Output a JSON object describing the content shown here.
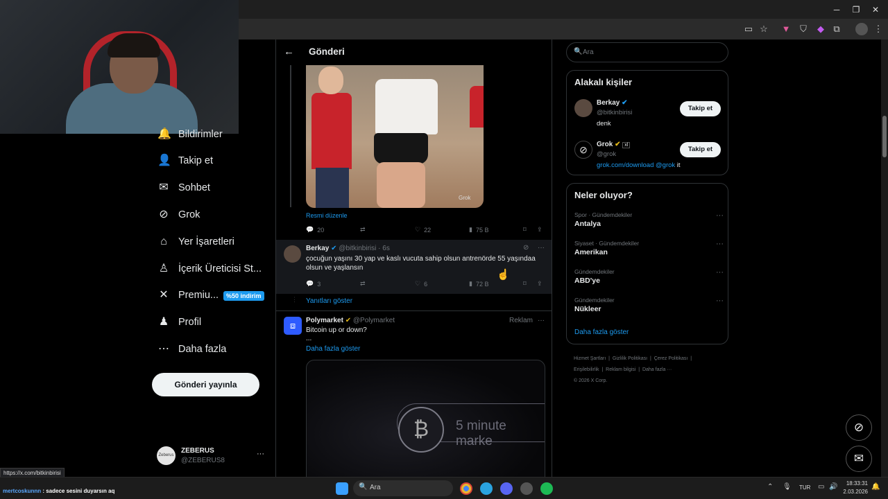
{
  "window": {
    "minimize_icon": "─",
    "maximize_icon": "❐",
    "close_icon": "✕"
  },
  "left_nav": {
    "items": [
      {
        "label": "Bildirimler",
        "icon": "bell-icon",
        "glyph": "🔔"
      },
      {
        "label": "Takip et",
        "icon": "person-plus-icon",
        "glyph": "⁺"
      },
      {
        "label": "Sohbet",
        "icon": "mail-icon",
        "glyph": "✉"
      },
      {
        "label": "Grok",
        "icon": "grok-icon",
        "glyph": "⊘"
      },
      {
        "label": "Yer İşaretleri",
        "icon": "bookmark-icon",
        "glyph": "🔖"
      },
      {
        "label": "İçerik Üreticisi St...",
        "icon": "creator-icon",
        "glyph": "♙"
      },
      {
        "label": "Premiu...",
        "icon": "x-logo-icon",
        "glyph": "✕"
      },
      {
        "label": "Profil",
        "icon": "profile-icon",
        "glyph": "👤"
      },
      {
        "label": "Daha fazla",
        "icon": "more-circle-icon",
        "glyph": "⋯"
      }
    ],
    "premium_badge": "%50 indirim",
    "post_button": "Gönderi yayınla",
    "profile": {
      "name": "ZEBERUS",
      "handle": "@ZEBERUS8",
      "avatar_text": "Zeberus",
      "menu": "···"
    }
  },
  "center": {
    "header_title": "Gönderi",
    "image_watermark": "Grok",
    "edited_label": "Resmi düzenle",
    "main_actions": {
      "replies": "20",
      "likes": "22",
      "views": "75 B"
    },
    "reply": {
      "name": "Berkay",
      "handle": "@bitkinbirisi",
      "time": "· 6s",
      "text": "çocuğun yaşını 30 yap ve kaslı vucuta sahip olsun antrenörde 55 yaşındaa olsun ve yaşlansın",
      "replies": "3",
      "likes": "6",
      "views": "72 B"
    },
    "show_replies": "Yanıtları göster",
    "ad": {
      "name": "Polymarket",
      "handle": "@Polymarket",
      "tag": "Reklam",
      "text": "Bitcoin up or down?",
      "ellipsis": "...",
      "show_more": "Daha fazla göster",
      "image_text": "5 minute marke",
      "coin_symbol": "₿"
    }
  },
  "right": {
    "search_placeholder": "Ara",
    "related_title": "Alakalı kişiler",
    "people": [
      {
        "name": "Berkay",
        "handle": "@bitkinbirisi",
        "bio": "denk",
        "button": "Takip et"
      },
      {
        "name": "Grok",
        "handle": "@grok",
        "bio_link": "grok.com/download @grok",
        "bio_tail": " it",
        "button": "Takip et",
        "tag": "xl"
      }
    ],
    "trends_title": "Neler oluyor?",
    "trends": [
      {
        "meta": "Spor · Gündemdekiler",
        "name": "Antalya"
      },
      {
        "meta": "Siyaset · Gündemdekiler",
        "name": "Amerikan"
      },
      {
        "meta": "Gündemdekiler",
        "name": "ABD'ye"
      },
      {
        "meta": "Gündemdekiler",
        "name": "Nükleer"
      }
    ],
    "trends_more": "Daha fazla göster",
    "footer_links": [
      "Hizmet Şartları",
      "Gizlilik Politikası",
      "Çerez Politikası",
      "Erişilebilirlik",
      "Reklam bilgisi",
      "Daha fazla ···"
    ],
    "copyright": "© 2026 X Corp."
  },
  "status_url": "https://x.com/bitkinbirisi",
  "chat": {
    "user": "mertcoskunnn",
    "message": " : sadece sesini duyarsın aq"
  },
  "taskbar": {
    "search": "Ara",
    "lang": "TUR",
    "time": "18:33:31",
    "date": "2.03.2026",
    "colors": {
      "start": "#3aa0ff",
      "chrome": "#e8b531",
      "telegram": "#2aa3e0",
      "discord": "#5865f2",
      "spotify": "#1db954"
    }
  },
  "colors": {
    "accent": "#1d9bf0",
    "verified_gold": "#e2b719",
    "bg": "#000000"
  }
}
